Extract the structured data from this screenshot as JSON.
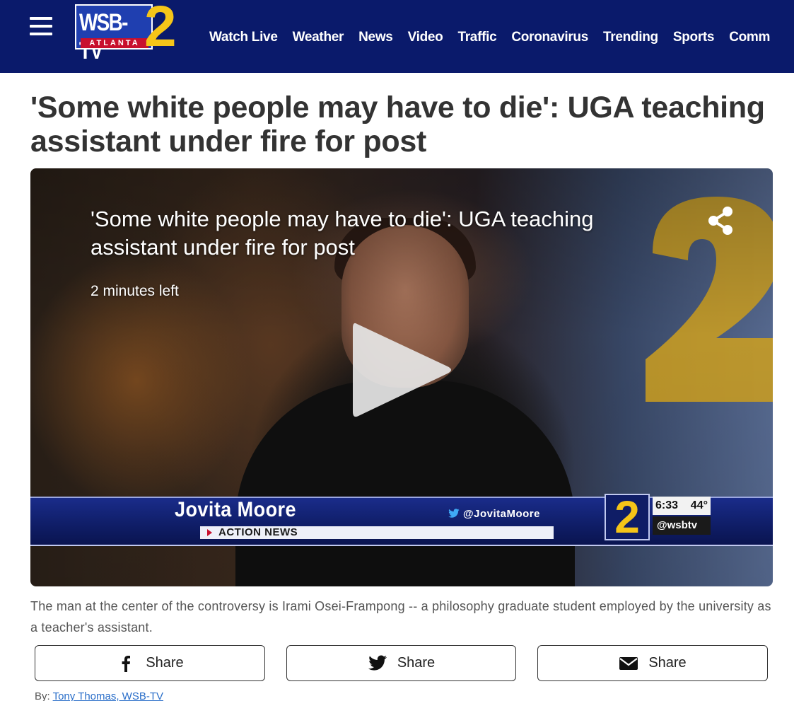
{
  "header": {
    "logo": {
      "station": "WSB-TV",
      "city": "ATLANTA",
      "channel": "2"
    },
    "nav": [
      {
        "label": "Watch Live"
      },
      {
        "label": "Weather"
      },
      {
        "label": "News"
      },
      {
        "label": "Video"
      },
      {
        "label": "Traffic"
      },
      {
        "label": "Coronavirus"
      },
      {
        "label": "Trending"
      },
      {
        "label": "Sports"
      },
      {
        "label": "Comm"
      }
    ],
    "colors": {
      "background": "#0a1a6b",
      "logo_yellow": "#f5c518",
      "logo_red": "#c8102e"
    }
  },
  "article": {
    "headline": "'Some white people may have to die': UGA teaching assistant under fire for post",
    "caption": "The man at the center of the controversy is Irami Osei-Frampong -- a philosophy graduate student employed by the university as a teacher's assistant.",
    "byline": {
      "prefix": "By: ",
      "author": "Tony Thomas, WSB-TV"
    }
  },
  "video": {
    "title": "'Some white people may have to die': UGA teaching assistant under fire for post",
    "time_left": "2 minutes left",
    "share_icon": "share-icon",
    "play_icon": "play-icon",
    "lower_third": {
      "name": "Jovita Moore",
      "program": "ACTION NEWS",
      "twitter_handle": "@JovitaMoore",
      "channel": "2",
      "time": "6:33",
      "temperature": "44°",
      "station_handle": "@wsbtv"
    }
  },
  "share": {
    "facebook": {
      "label": "Share",
      "icon": "facebook-icon"
    },
    "twitter": {
      "label": "Share",
      "icon": "twitter-icon"
    },
    "email": {
      "label": "Share",
      "icon": "email-icon"
    }
  }
}
